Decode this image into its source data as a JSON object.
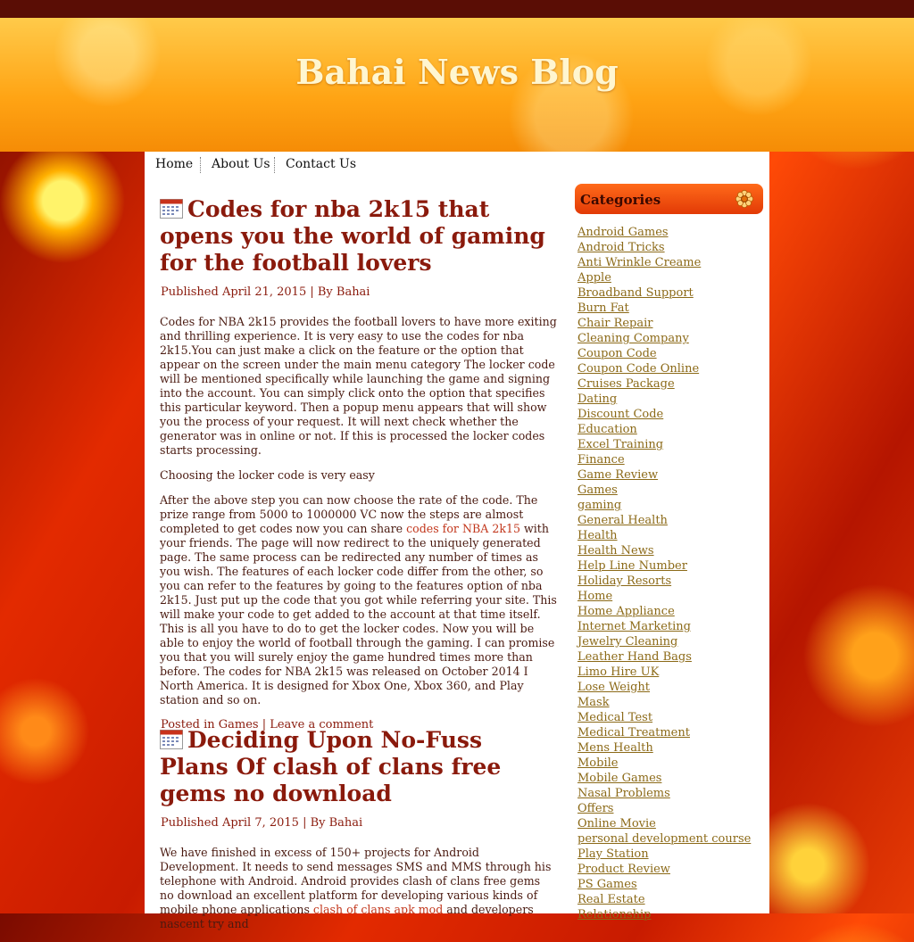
{
  "site": {
    "title": "Bahai News Blog"
  },
  "nav": {
    "items": [
      "Home",
      "About Us",
      "Contact Us"
    ]
  },
  "posts": [
    {
      "title": "Codes for nba 2k15 that opens you the world of gaming for the football lovers",
      "meta": "Published April 21, 2015 | By Bahai",
      "paragraphs": [
        "Codes for NBA 2k15 provides the football lovers to have more exiting and thrilling experience. It is very easy to use the codes for nba 2k15.You can just make a click on the feature or the option that appear on the screen under the main menu category The locker code will be mentioned  specifically while launching the game and signing into the account. You can simply click onto the option that specifies this particular keyword. Then a popup menu appears that will show you the process of your request. It will next check whether the generator was in online or not. If this is processed the locker codes starts processing.",
        "Choosing the locker code is very easy"
      ],
      "p3_before": "After the above step you can now choose the rate of the code. The prize range from 5000 to 1000000 VC now the steps are almost completed to get codes now you can share ",
      "p3_link": "codes for NBA 2k15",
      "p3_after": " with your friends. The page will now redirect to the uniquely generated page. The same process can be redirected any number of times as you wish. The features of each locker code differ from the other, so you can refer to the features by going to the features option of nba 2k15. Just put up the code that you got while referring your site. This will make your code to get added to the account at that time itself. This is all you have to do to get the locker codes. Now you will be able to enjoy the world of football through the gaming. I can promise you that you will surely enjoy the game hundred times more than before. The codes for NBA 2k15 was released on October 2014 I North America. It is designed for Xbox One, Xbox 360, and Play station and so on.",
      "footer": "Posted in Games | Leave a comment"
    },
    {
      "title": "Deciding Upon No-Fuss Plans Of clash of clans free gems no download",
      "meta": "Published April 7, 2015 | By Bahai",
      "p1_before": "We have finished in excess of 150+ projects for Android Development. It needs to send messages SMS and MMS through his telephone with Android.  Android provides clash of clans free gems no download an excellent platform for developing various kinds of mobile phone applications ",
      "p1_link": "clash of clans apk mod",
      "p1_after": " and developers nascent try and"
    }
  ],
  "sidebar": {
    "categories_title": "Categories",
    "categories": [
      "Android Games",
      "Android Tricks",
      "Anti Wrinkle Creame",
      "Apple",
      "Broadband Support",
      "Burn Fat",
      "Chair Repair",
      "Cleaning Company",
      "Coupon Code",
      "Coupon Code Online",
      "Cruises Package",
      "Dating",
      "Discount Code",
      "Education",
      "Excel Training",
      "Finance",
      "Game Review",
      "Games",
      "gaming",
      "General Health",
      "Health",
      "Health News",
      "Help Line Number",
      "Holiday Resorts",
      "Home",
      "Home Appliance",
      "Internet Marketing",
      "Jewelry Cleaning",
      "Leather Hand Bags",
      "Limo Hire UK",
      "Lose Weight",
      "Mask",
      "Medical Test",
      "Medical Treatment",
      "Mens Health",
      "Mobile",
      "Mobile Games",
      "Nasal Problems",
      "Offers",
      "Online Movie",
      "personal development course",
      "Play Station",
      "Product Review",
      "PS Games",
      "Real Estate",
      "Relationship"
    ]
  }
}
